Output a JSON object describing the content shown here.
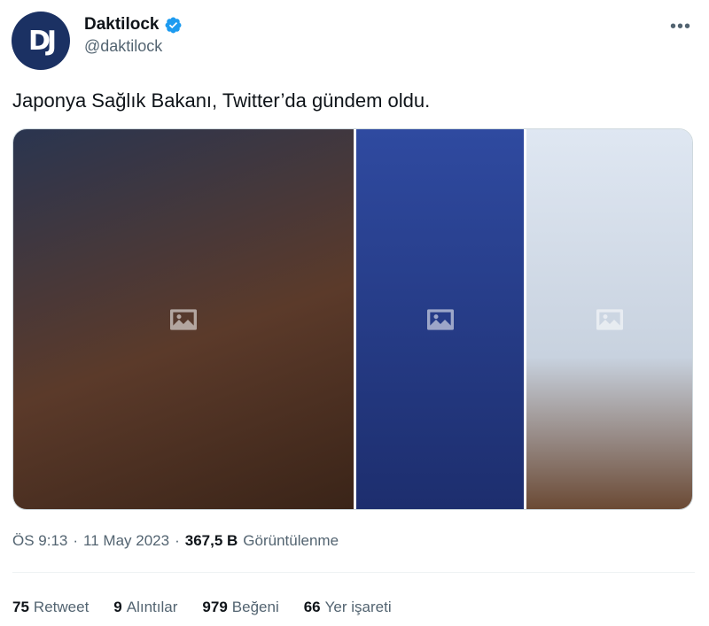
{
  "author": {
    "avatar_initials": "DJ",
    "display_name": "Daktilock",
    "handle": "@daktilock",
    "verified": true
  },
  "tweet": {
    "text": "Japonya Sağlık Bakanı, Twitter’da gündem oldu.",
    "photos": [
      {
        "icon": "image-icon"
      },
      {
        "icon": "image-icon"
      },
      {
        "icon": "image-icon"
      }
    ]
  },
  "meta": {
    "time": "ÖS 9:13",
    "separator": "·",
    "date": "11 May 2023",
    "views_count": "367,5 B",
    "views_label": "Görüntülenme"
  },
  "stats": {
    "retweets": {
      "count": "75",
      "label": "Retweet"
    },
    "quotes": {
      "count": "9",
      "label": "Alıntılar"
    },
    "likes": {
      "count": "979",
      "label": "Beğeni"
    },
    "bookmarks": {
      "count": "66",
      "label": "Yer işareti"
    }
  },
  "colors": {
    "verified": "#1d9bf0",
    "avatar_bg": "#1b3163",
    "secondary_text": "#536471"
  },
  "more_glyph": "•••"
}
